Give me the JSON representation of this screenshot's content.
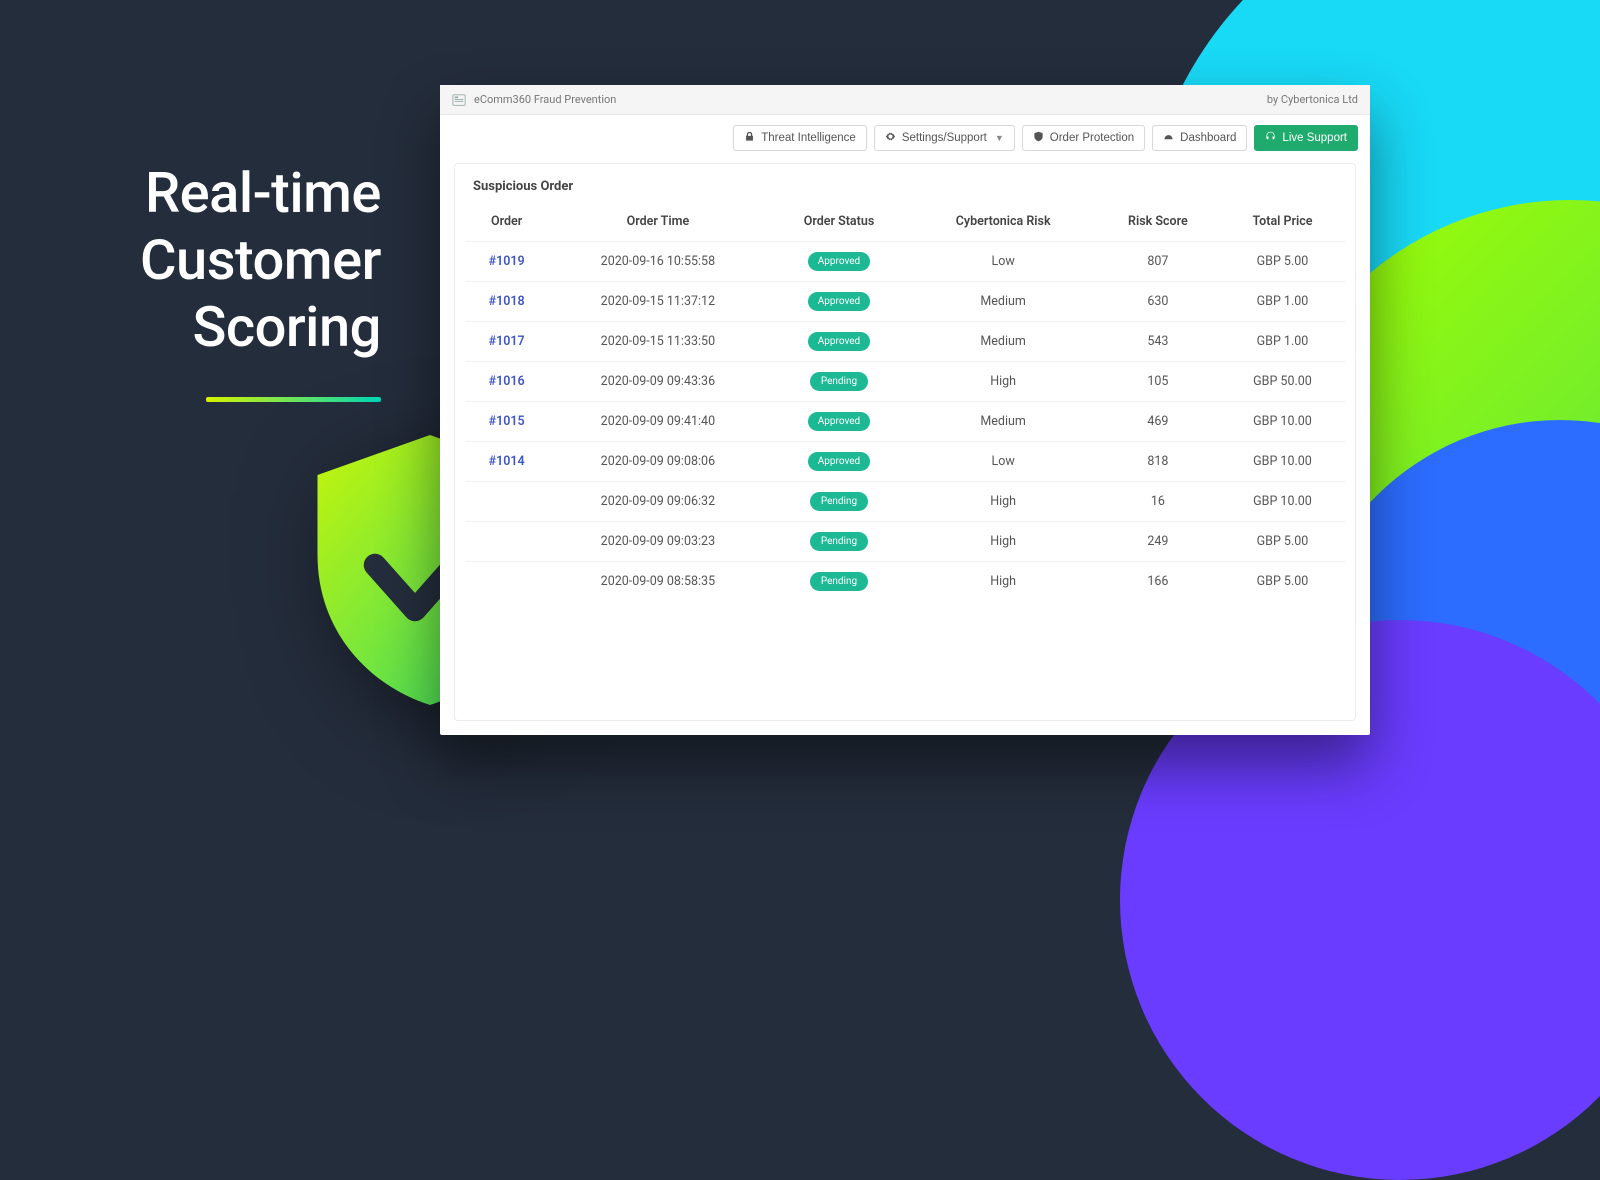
{
  "hero": {
    "line1": "Real-time",
    "line2": "Customer",
    "line3": "Scoring"
  },
  "titlebar": {
    "app_name": "eComm360 Fraud Prevention",
    "byline": "by Cybertonica Ltd"
  },
  "toolbar": {
    "threat_intel": "Threat Intelligence",
    "settings": "Settings/Support",
    "order_protection": "Order Protection",
    "dashboard": "Dashboard",
    "live_support": "Live Support"
  },
  "card": {
    "title": "Suspicious Order",
    "columns": {
      "order": "Order",
      "order_time": "Order Time",
      "order_status": "Order Status",
      "risk": "Cybertonica Risk",
      "score": "Risk Score",
      "total": "Total Price"
    },
    "rows": [
      {
        "order": "#1019",
        "time": "2020-09-16 10:55:58",
        "status": "Approved",
        "risk": "Low",
        "score": "807",
        "total": "GBP 5.00"
      },
      {
        "order": "#1018",
        "time": "2020-09-15 11:37:12",
        "status": "Approved",
        "risk": "Medium",
        "score": "630",
        "total": "GBP 1.00"
      },
      {
        "order": "#1017",
        "time": "2020-09-15 11:33:50",
        "status": "Approved",
        "risk": "Medium",
        "score": "543",
        "total": "GBP 1.00"
      },
      {
        "order": "#1016",
        "time": "2020-09-09 09:43:36",
        "status": "Pending",
        "risk": "High",
        "score": "105",
        "total": "GBP 50.00"
      },
      {
        "order": "#1015",
        "time": "2020-09-09 09:41:40",
        "status": "Approved",
        "risk": "Medium",
        "score": "469",
        "total": "GBP 10.00"
      },
      {
        "order": "#1014",
        "time": "2020-09-09 09:08:06",
        "status": "Approved",
        "risk": "Low",
        "score": "818",
        "total": "GBP 10.00"
      },
      {
        "order": "",
        "time": "2020-09-09 09:06:32",
        "status": "Pending",
        "risk": "High",
        "score": "16",
        "total": "GBP 10.00"
      },
      {
        "order": "",
        "time": "2020-09-09 09:03:23",
        "status": "Pending",
        "risk": "High",
        "score": "249",
        "total": "GBP 5.00"
      },
      {
        "order": "",
        "time": "2020-09-09 08:58:35",
        "status": "Pending",
        "risk": "High",
        "score": "166",
        "total": "GBP 5.00"
      }
    ]
  }
}
